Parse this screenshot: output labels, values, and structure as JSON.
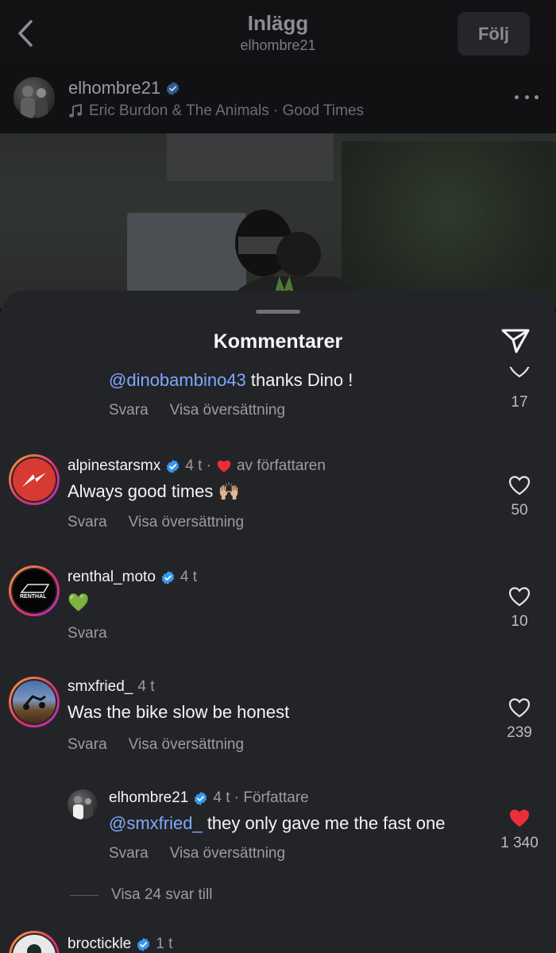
{
  "topbar": {
    "title": "Inlägg",
    "subtitle": "elhombre21",
    "follow_label": "Följ"
  },
  "post": {
    "username": "elhombre21",
    "music": "Eric Burdon & The Animals · Good Times"
  },
  "comments_sheet": {
    "title": "Kommentarer"
  },
  "comments": [
    {
      "mention": "@dinobambino43",
      "text": " thanks Dino !",
      "reply_label": "Svara",
      "translate_label": "Visa översättning",
      "likes": "17"
    },
    {
      "username": "alpinestarsmx",
      "time": "4 t ·",
      "author_like_label": "av författaren",
      "text": "Always good times 🙌🏼",
      "reply_label": "Svara",
      "translate_label": "Visa översättning",
      "likes": "50"
    },
    {
      "username": "renthal_moto",
      "time": "4 t",
      "text": "💚",
      "reply_label": "Svara",
      "likes": "10"
    },
    {
      "username": "smxfried_",
      "time": "4 t",
      "text": "Was the bike slow be honest",
      "reply_label": "Svara",
      "translate_label": "Visa översättning",
      "likes": "239"
    },
    {
      "username": "elhombre21",
      "time": "4 t · Författare",
      "mention": "@smxfried_",
      "text": " they only gave me the fast one",
      "reply_label": "Svara",
      "translate_label": "Visa översättning",
      "likes": "1 340"
    },
    {
      "username": "broctickle",
      "time": "1 t"
    }
  ],
  "view_more_replies": "Visa 24 svar till",
  "colors": {
    "accent_blue": "#7fa8ff",
    "verified_blue": "#3897f0",
    "like_red": "#ed2d3c",
    "sheet_bg": "#232427"
  }
}
